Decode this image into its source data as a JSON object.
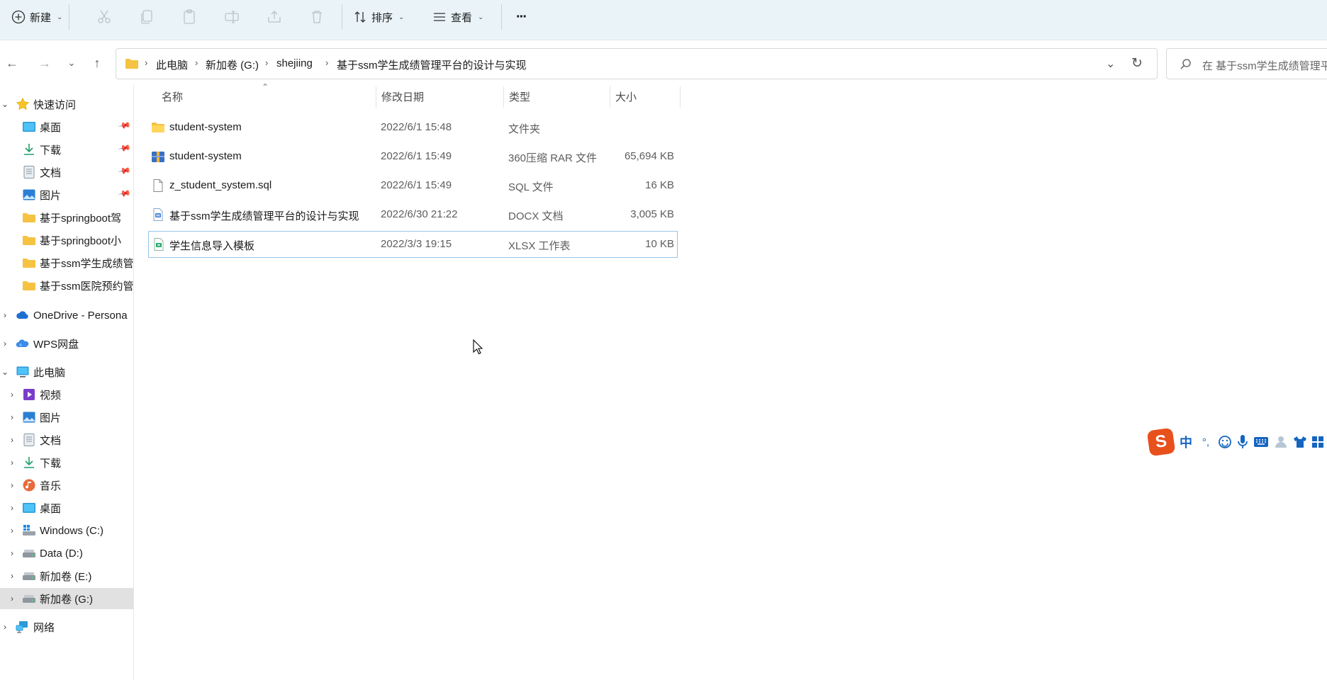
{
  "toolbar": {
    "new_label": "新建",
    "sort_label": "排序",
    "view_label": "查看",
    "more_label": "···"
  },
  "address": {
    "crumbs": [
      "此电脑",
      "新加卷 (G:)",
      "shejiing",
      "基于ssm学生成绩管理平台的设计与实现"
    ]
  },
  "search": {
    "placeholder": "在 基于ssm学生成绩管理平台的设计与实现 中搜索",
    "visible_text": "在 基于ssm学生成绩管理平"
  },
  "sidebar": {
    "quick_access": "快速访问",
    "quick_items": [
      {
        "label": "桌面",
        "icon": "desktop-icon",
        "pinned": true
      },
      {
        "label": "下载",
        "icon": "download-icon",
        "pinned": true
      },
      {
        "label": "文档",
        "icon": "document-icon",
        "pinned": true
      },
      {
        "label": "图片",
        "icon": "pictures-icon",
        "pinned": true
      },
      {
        "label": "基于springboot驾",
        "icon": "folder-icon",
        "pinned": false
      },
      {
        "label": "基于springboot小",
        "icon": "folder-icon",
        "pinned": false
      },
      {
        "label": "基于ssm学生成绩管",
        "icon": "folder-icon",
        "pinned": false
      },
      {
        "label": "基于ssm医院预约管",
        "icon": "folder-icon",
        "pinned": false
      }
    ],
    "onedrive": "OneDrive - Persona",
    "wps": "WPS网盘",
    "this_pc": "此电脑",
    "pc_items": [
      {
        "label": "视频",
        "icon": "video-icon"
      },
      {
        "label": "图片",
        "icon": "pictures-icon"
      },
      {
        "label": "文档",
        "icon": "document-icon"
      },
      {
        "label": "下载",
        "icon": "download-icon"
      },
      {
        "label": "音乐",
        "icon": "music-icon"
      },
      {
        "label": "桌面",
        "icon": "desktop-icon"
      },
      {
        "label": "Windows (C:)",
        "icon": "drive-windows-icon"
      },
      {
        "label": "Data (D:)",
        "icon": "drive-icon"
      },
      {
        "label": "新加卷 (E:)",
        "icon": "drive-icon"
      },
      {
        "label": "新加卷 (G:)",
        "icon": "drive-icon",
        "selected": true
      }
    ],
    "network": "网络"
  },
  "columns": {
    "name": "名称",
    "date": "修改日期",
    "type": "类型",
    "size": "大小"
  },
  "files": [
    {
      "name": "student-system",
      "date": "2022/6/1 15:48",
      "type": "文件夹",
      "size": "",
      "icon": "folder-icon"
    },
    {
      "name": "student-system",
      "date": "2022/6/1 15:49",
      "type": "360压缩 RAR 文件",
      "size": "65,694 KB",
      "icon": "rar-archive-icon"
    },
    {
      "name": "z_student_system.sql",
      "date": "2022/6/1 15:49",
      "type": "SQL 文件",
      "size": "16 KB",
      "icon": "sql-file-icon"
    },
    {
      "name": "基于ssm学生成绩管理平台的设计与实现",
      "date": "2022/6/30 21:22",
      "type": "DOCX 文档",
      "size": "3,005 KB",
      "icon": "docx-file-icon"
    },
    {
      "name": "学生信息导入模板",
      "date": "2022/3/3 19:15",
      "type": "XLSX 工作表",
      "size": "10 KB",
      "icon": "xlsx-file-icon",
      "selected": true
    }
  ],
  "ime": {
    "logo": "S",
    "mode": "中",
    "punct": "°,",
    "items": [
      "emoji-icon",
      "mic-icon",
      "keyboard-icon",
      "user-icon",
      "shirt-icon",
      "grid-icon"
    ]
  },
  "colors": {
    "toolbar_bg": "#eaf4f8",
    "folder": "#f5c242",
    "selection_border": "#99c5ea",
    "sidebar_selected": "#e1e1e1",
    "ime_logo": "#e8501c"
  }
}
